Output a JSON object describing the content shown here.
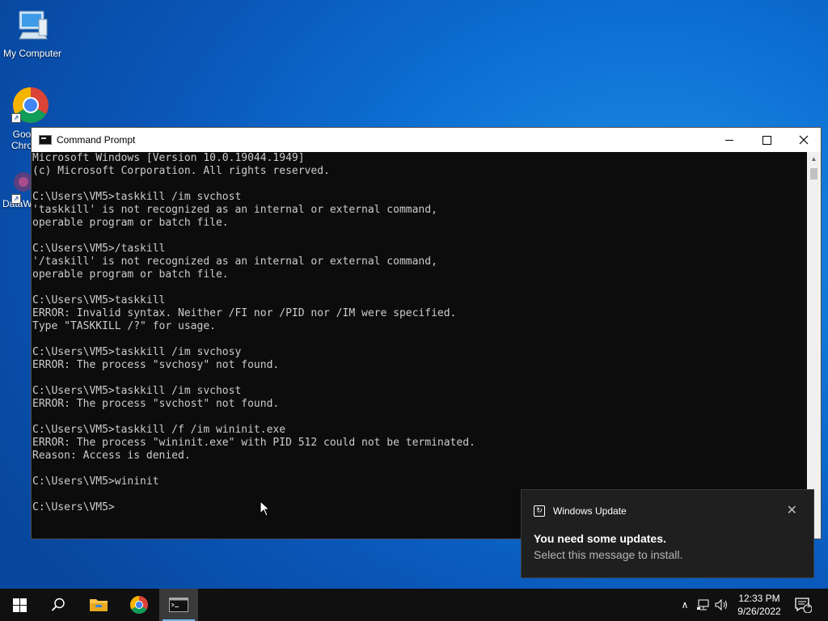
{
  "desktop": {
    "icons": [
      {
        "name": "my-computer",
        "label": "My Computer"
      },
      {
        "name": "google-chrome",
        "label": "Goo Chro"
      },
      {
        "name": "dataw",
        "label": "DataW"
      }
    ]
  },
  "cmd": {
    "title": "Command Prompt",
    "lines": [
      "Microsoft Windows [Version 10.0.19044.1949]",
      "(c) Microsoft Corporation. All rights reserved.",
      "",
      "C:\\Users\\VM5>taskkill /im svchost",
      "'taskkill' is not recognized as an internal or external command,",
      "operable program or batch file.",
      "",
      "C:\\Users\\VM5>/taskill",
      "'/taskill' is not recognized as an internal or external command,",
      "operable program or batch file.",
      "",
      "C:\\Users\\VM5>taskkill",
      "ERROR: Invalid syntax. Neither /FI nor /PID nor /IM were specified.",
      "Type \"TASKKILL /?\" for usage.",
      "",
      "C:\\Users\\VM5>taskkill /im svchosy",
      "ERROR: The process \"svchosy\" not found.",
      "",
      "C:\\Users\\VM5>taskkill /im svchost",
      "ERROR: The process \"svchost\" not found.",
      "",
      "C:\\Users\\VM5>taskkill /f /im wininit.exe",
      "ERROR: The process \"wininit.exe\" with PID 512 could not be terminated.",
      "Reason: Access is denied.",
      "",
      "C:\\Users\\VM5>wininit",
      "",
      "C:\\Users\\VM5>"
    ]
  },
  "toast": {
    "app": "Windows Update",
    "title": "You need some updates.",
    "body": "Select this message to install."
  },
  "taskbar": {
    "time": "12:33 PM",
    "date": "9/26/2022",
    "notification_count": "1"
  },
  "colors": {
    "console_bg": "#0c0c0c",
    "console_text": "#cccccc",
    "taskbar_bg": "#101010",
    "accent": "#76b9ed"
  }
}
